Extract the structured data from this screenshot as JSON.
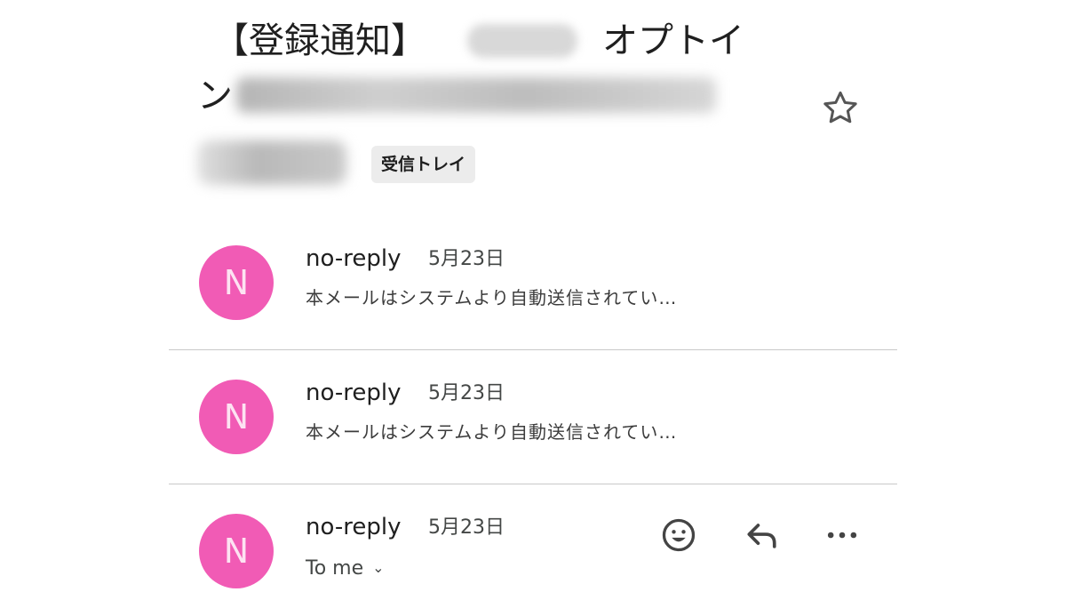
{
  "subject": {
    "line1_prefix": "【登録通知】",
    "line1_suffix": "オプトイ",
    "line2_prefix": "ン",
    "inbox_badge": "受信トレイ"
  },
  "messages": [
    {
      "avatar_letter": "N",
      "sender": "no-reply",
      "date": "5月23日",
      "snippet": "本メールはシステムより自動送信されてい…"
    },
    {
      "avatar_letter": "N",
      "sender": "no-reply",
      "date": "5月23日",
      "snippet": "本メールはシステムより自動送信されてい…"
    },
    {
      "avatar_letter": "N",
      "sender": "no-reply",
      "date": "5月23日",
      "recipient": "To me"
    }
  ],
  "icons": {
    "star": "star-outline-icon",
    "emoji": "emoji-smile-icon",
    "reply": "reply-icon",
    "more": "more-horizontal-icon",
    "chevron": "chevron-down-icon"
  },
  "colors": {
    "avatar": "#f15bb5",
    "divider": "#c9c9c9",
    "badge_bg": "#ececec"
  }
}
